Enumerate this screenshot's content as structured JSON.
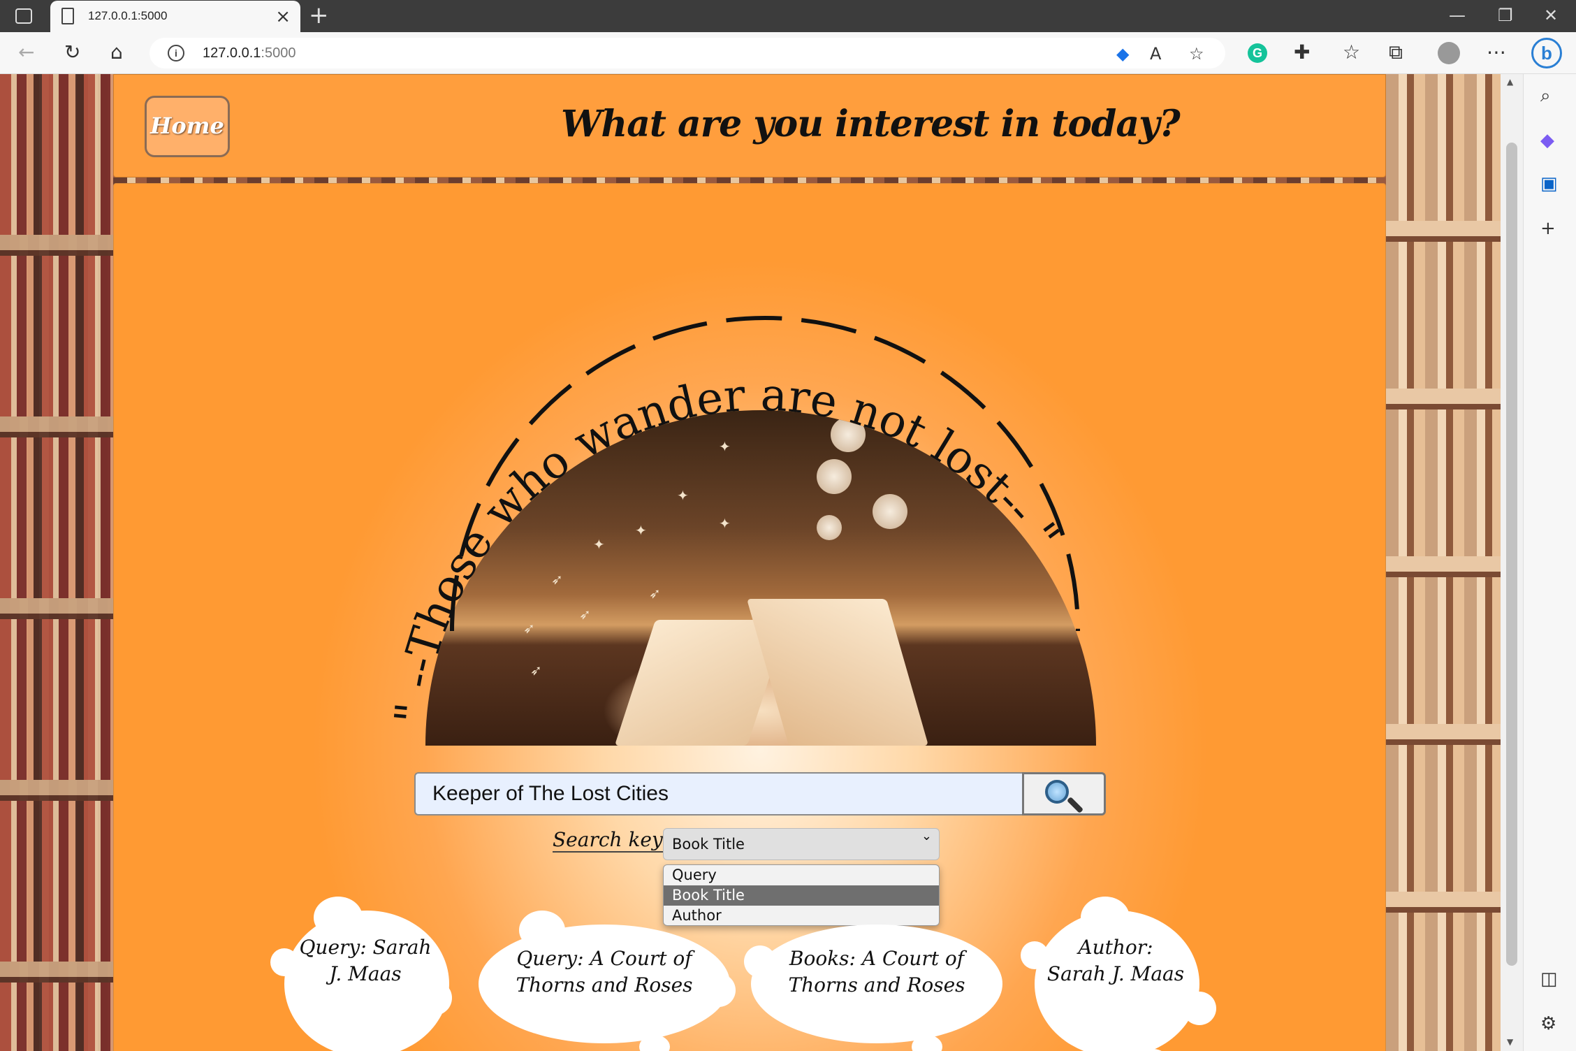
{
  "browser": {
    "tab_title": "127.0.0.1:5000",
    "address_host": "127.0.0.1",
    "address_port": ":5000",
    "icons": [
      "tab-actions-icon",
      "back-icon",
      "refresh-icon",
      "home-icon",
      "info-icon",
      "extensions-icon",
      "favorites-icon",
      "collections-icon",
      "profile-icon",
      "more-icon",
      "bing-icon"
    ]
  },
  "header": {
    "home_label": "Home",
    "title": "What are you interest in today?"
  },
  "hero": {
    "quote_words": [
      "\"",
      "--Those",
      "who",
      "wander",
      "are",
      "not",
      "lost--",
      "\""
    ]
  },
  "search": {
    "value": "Keeper of The Lost Cities",
    "key_label": "Search key:",
    "selected": "Book Title",
    "options": [
      "Query",
      "Book Title",
      "Author"
    ]
  },
  "suggestions": [
    {
      "text": "Query: Sarah J. Maas"
    },
    {
      "text": "Query: A Court of Thorns and Roses"
    },
    {
      "text": "Books: A Court of Thorns and Roses"
    },
    {
      "text": "Author: Sarah J. Maas"
    }
  ]
}
